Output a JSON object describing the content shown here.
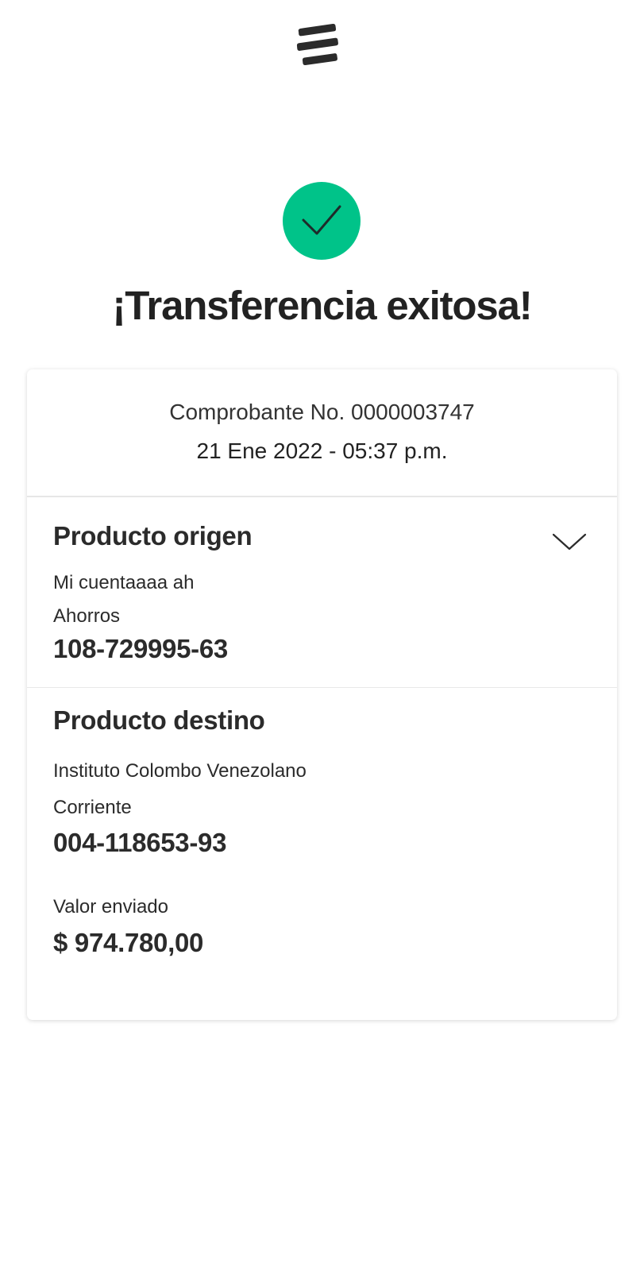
{
  "header": {
    "logo_icon": "bancolombia-logo-icon"
  },
  "status": {
    "icon": "checkmark-icon",
    "color": "#00c389",
    "title": "¡Transferencia exitosa!"
  },
  "receipt": {
    "number_text": "Comprobante No. 0000003747",
    "datetime": "21 Ene 2022 - 05:37 p.m."
  },
  "origin": {
    "heading": "Producto origen",
    "account_name": "Mi cuentaaaa ah",
    "account_type": "Ahorros",
    "account_number": "108-729995-63",
    "toggle_icon": "chevron-down-icon"
  },
  "destination": {
    "heading": "Producto destino",
    "account_name": "Instituto Colombo Venezolano",
    "account_type": "Corriente",
    "account_number": "004-118653-93",
    "amount_label": "Valor enviado",
    "amount_value": "$ 974.780,00"
  }
}
